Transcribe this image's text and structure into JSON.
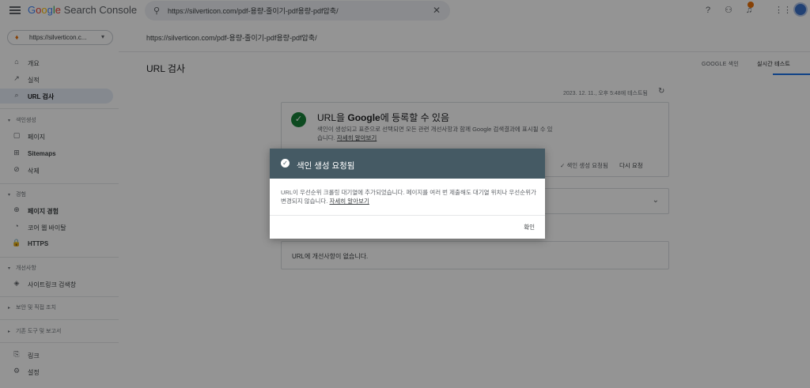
{
  "header": {
    "app_title_brand": [
      "G",
      "o",
      "o",
      "g",
      "l",
      "e"
    ],
    "app_title_rest": " Search Console",
    "search_value": "https://silverticon.com/pdf-용량-줄이기-pdf용량-pdf압축/",
    "icons": [
      "menu-icon",
      "search-icon",
      "close-icon",
      "help-icon",
      "manage-accounts-icon",
      "notifications-icon",
      "apps-icon",
      "avatar"
    ]
  },
  "sidebar": {
    "property_label": "https://silverticon.c...",
    "items": [
      {
        "icon": "⌂",
        "label": "개요"
      },
      {
        "icon": "↗",
        "label": "실적"
      },
      {
        "icon": "⌕",
        "label": "URL 검사"
      },
      {
        "icon": "▢",
        "label": "페이지"
      },
      {
        "icon": "⊞",
        "label": "Sitemaps"
      },
      {
        "icon": "⊘",
        "label": "삭제"
      },
      {
        "icon": "⊕",
        "label": "페이지 경험"
      },
      {
        "icon": "◔",
        "label": "코어 웹 바이탈"
      },
      {
        "icon": "🔒",
        "label": "HTTPS"
      },
      {
        "icon": "◈",
        "label": "사이트링크 검색창"
      },
      {
        "icon": "⎘",
        "label": "링크"
      },
      {
        "icon": "⚙",
        "label": "설정"
      }
    ],
    "sections": {
      "indexing": "색인생성",
      "experience": "경험",
      "enhancements": "개선사항",
      "security": "보안 및 직접 조치",
      "legacy": "기존 도구 및 보고서"
    }
  },
  "main": {
    "url": "https://silverticon.com/pdf-용량-줄이기-pdf용량-pdf압축/",
    "page_title": "URL 검사",
    "tabs": [
      "GOOGLE 색인",
      "실시간 테스트"
    ],
    "selected_tab": 1,
    "tested_at": "2023. 12. 11., 오후 5:48에 테스트됨",
    "result_card": {
      "title_pre": "URL을 ",
      "title_brand": "Google",
      "title_post": "에 등록할 수 있음",
      "description": "색인이 생성되고 표준으로 선택되면 모든 관련 개선사항과 함께 Google 검색결과에 표시될 수 있습니다.",
      "learn_more": "자세히 알아보기",
      "requested": "색인 생성 요청됨",
      "request_again": "다시 요청"
    },
    "improvements_text": "URL에 개선사항이 없습니다."
  },
  "dialog": {
    "title": "색인 생성 요청됨",
    "body": "URL이 우선순위 크롤링 대기열에 추가되었습니다. 페이지를 여러 번 제출해도 대기열 위치나 우선순위가 변경되지 않습니다.",
    "learn_more": "자세히 알아보기",
    "ok": "확인",
    "header_color": "#455a64"
  }
}
